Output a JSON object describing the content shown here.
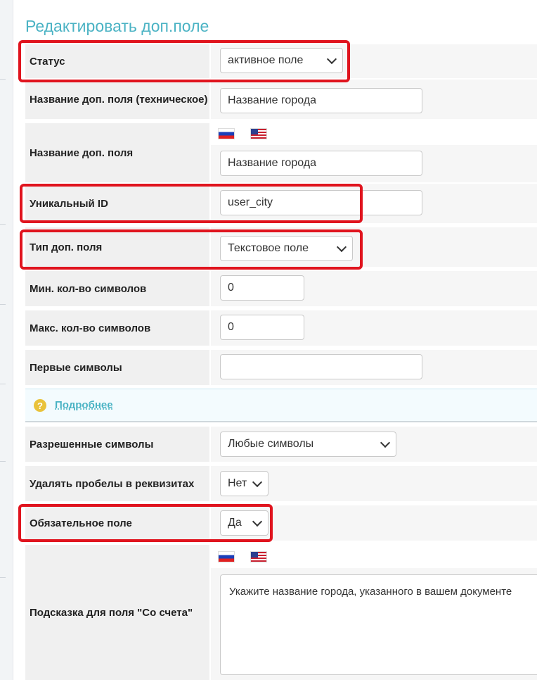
{
  "title": "Редактировать доп.поле",
  "fields": {
    "status": {
      "label": "Статус",
      "value": "активное поле"
    },
    "tech_name": {
      "label": "Название доп. поля (техническое)",
      "value": "Название города"
    },
    "name": {
      "label": "Название доп. поля",
      "value": "Название города"
    },
    "unique_id": {
      "label": "Уникальный ID",
      "value": "user_city"
    },
    "type": {
      "label": "Тип доп. поля",
      "value": "Текстовое поле"
    },
    "min_chars": {
      "label": "Мин. кол-во символов",
      "value": "0"
    },
    "max_chars": {
      "label": "Макс. кол-во символов",
      "value": "0"
    },
    "first_chars": {
      "label": "Первые символы",
      "value": ""
    },
    "allowed_chars": {
      "label": "Разрешенные символы",
      "value": "Любые символы"
    },
    "remove_spaces": {
      "label": "Удалять пробелы в реквизитах",
      "value": "Нет"
    },
    "required": {
      "label": "Обязательное поле",
      "value": "Да"
    },
    "hint": {
      "label": "Подсказка для поля \"Со счета\"",
      "value": "Укажите название города, указанного в вашем документе"
    }
  },
  "info": {
    "icon": "question-icon",
    "symbol": "?",
    "link": "Подробнее"
  },
  "flags": [
    "flag-ru-icon",
    "flag-us-icon"
  ],
  "highlight_color": "#e0141e",
  "accent_color": "#4bb3c4"
}
